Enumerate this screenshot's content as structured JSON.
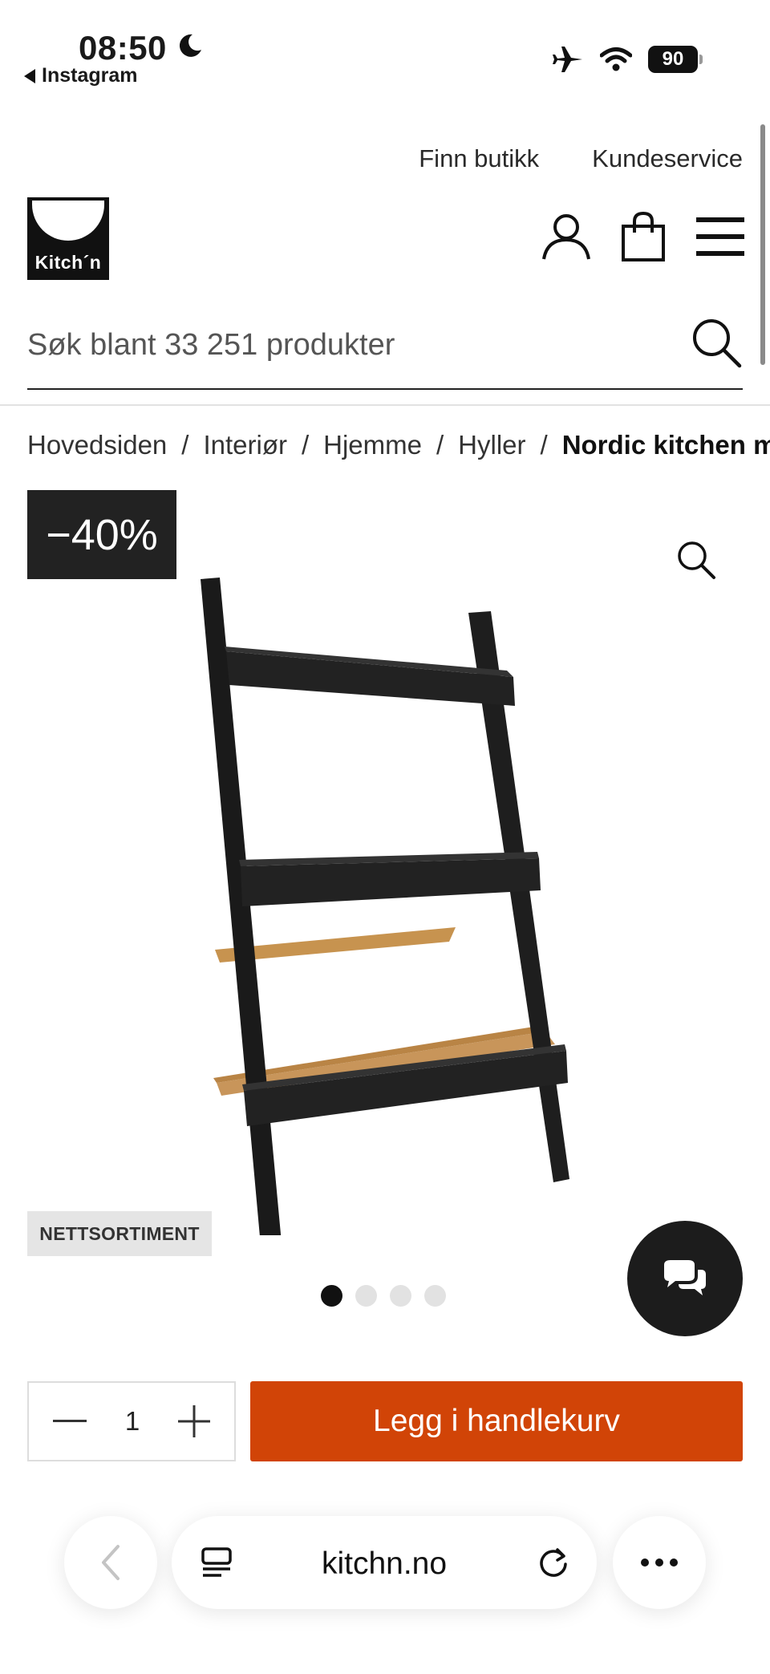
{
  "status_bar": {
    "time": "08:50",
    "back_app": "Instagram",
    "battery": "90"
  },
  "top_links": [
    "Finn butikk",
    "Kundeservice"
  ],
  "logo": {
    "text": "Kitch´n"
  },
  "search": {
    "placeholder": "Søk blant 33 251 produkter"
  },
  "breadcrumb": {
    "items": [
      "Hovedsiden",
      "Interiør",
      "Hjemme",
      "Hyller"
    ],
    "current": "Nordic kitchen m"
  },
  "product": {
    "discount": "−40%",
    "badge": "NETTSORTIMENT",
    "image_count": 4,
    "active_image": 1
  },
  "purchase": {
    "quantity": "1",
    "add_to_cart": "Legg i handlekurv",
    "accent_color": "#d14407"
  },
  "browser": {
    "url": "kitchn.no"
  },
  "icons": [
    "moon-icon",
    "airplane-icon",
    "wifi-icon",
    "user-icon",
    "shopping-bag-icon",
    "menu-icon",
    "search-icon",
    "zoom-icon",
    "chat-icon",
    "minus-icon",
    "plus-icon",
    "back-icon",
    "reader-icon",
    "reload-icon",
    "more-icon"
  ]
}
